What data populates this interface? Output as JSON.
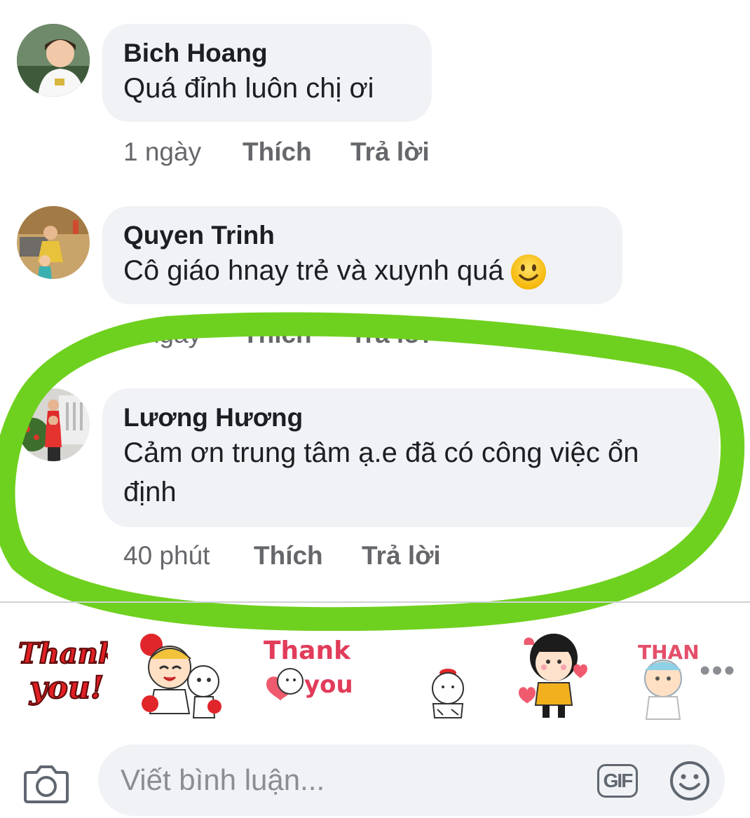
{
  "comments": [
    {
      "author": "Bich Hoang",
      "text": "Quá đỉnh luôn chị ơi",
      "time": "1 ngày",
      "like_label": "Thích",
      "reply_label": "Trả lời"
    },
    {
      "author": "Quyen Trinh",
      "text": "Cô giáo hnay trẻ và xuynh quá",
      "emoji": "slightly-smiling-face-icon",
      "time": "1 ngày",
      "like_label": "Thích",
      "reply_label": "Trả lời"
    },
    {
      "author": "Lương Hương",
      "text_line1": "Cảm ơn trung tâm ạ.e đã có công việc ổn",
      "text_line2": "định",
      "time": "40 phút",
      "like_label": "Thích",
      "reply_label": "Trả lời"
    }
  ],
  "stickers": [
    {
      "name": "thank-you-red-sticker",
      "label_line1": "Thank",
      "label_line2": "you!"
    },
    {
      "name": "cheerleader-bear-sticker"
    },
    {
      "name": "thank-you-sheep-sticker",
      "label_line1": "Thank",
      "label_line2": "you"
    },
    {
      "name": "sheep-sticker"
    },
    {
      "name": "girl-yellow-shirt-sticker"
    },
    {
      "name": "thank-kid-sticker",
      "label": "THAN"
    }
  ],
  "composer": {
    "placeholder": "Viết bình luận...",
    "gif_label": "GIF"
  },
  "colors": {
    "bubble": "#f0f2f5",
    "meta_text": "#65676b",
    "highlight": "#6fd11f"
  }
}
